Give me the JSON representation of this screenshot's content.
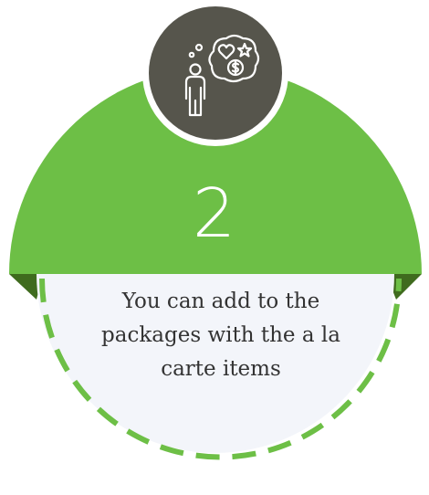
{
  "step": {
    "number": "2",
    "description": "You can add to the packages with the a la carte items"
  },
  "icon": {
    "name": "person-thinking-desires-icon"
  },
  "colors": {
    "green": "#6dbf46",
    "dark_green": "#3f6b1e",
    "badge": "#56554c",
    "card": "#f3f5fa",
    "dash": "#6dbf46"
  }
}
